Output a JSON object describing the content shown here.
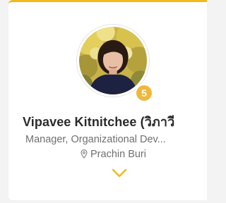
{
  "card": {
    "badge_count": "5",
    "name": "Vipavee Kitnitchee (วิภาวี",
    "job_title": "Manager, Organizational Dev...",
    "location": "Prachin Buri",
    "icons": {
      "location": "map-pin-icon",
      "expand": "chevron-down-icon"
    },
    "colors": {
      "accent": "#f2b91b",
      "badge": "#f0b73a",
      "name_text": "#2b2b2b",
      "secondary_text": "#6f6f6f"
    }
  }
}
